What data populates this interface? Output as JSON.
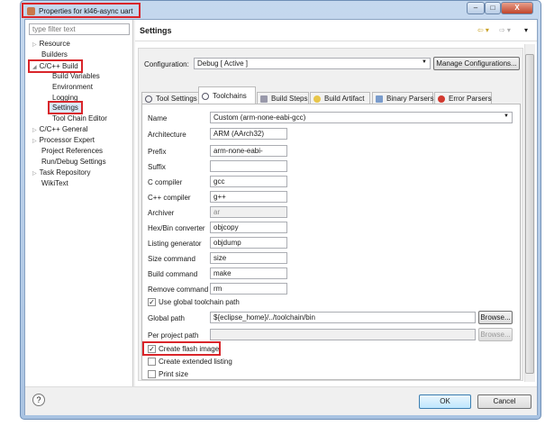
{
  "window": {
    "title": "Properties for kl46-async uart",
    "minimize": "–",
    "maximize": "□",
    "close": "X"
  },
  "filter": {
    "placeholder": "type filter text"
  },
  "tree": [
    {
      "label": "Resource",
      "expander": "▷"
    },
    {
      "label": "Builders",
      "expander": ""
    },
    {
      "label": "C/C++ Build",
      "expander": "◢"
    },
    {
      "label": "Build Variables",
      "expander": ""
    },
    {
      "label": "Environment",
      "expander": ""
    },
    {
      "label": "Logging",
      "expander": ""
    },
    {
      "label": "Settings",
      "expander": ""
    },
    {
      "label": "Tool Chain Editor",
      "expander": ""
    },
    {
      "label": "C/C++ General",
      "expander": "▷"
    },
    {
      "label": "Processor Expert",
      "expander": "▷"
    },
    {
      "label": "Project References",
      "expander": ""
    },
    {
      "label": "Run/Debug Settings",
      "expander": ""
    },
    {
      "label": "Task Repository",
      "expander": "▷"
    },
    {
      "label": "WikiText",
      "expander": ""
    }
  ],
  "header": {
    "title": "Settings",
    "back": "⇦ ▾",
    "forward": "⇨ ▾",
    "menu": "▾"
  },
  "config": {
    "label": "Configuration:",
    "value": "Debug  [ Active ]",
    "manage": "Manage Configurations..."
  },
  "tabs": [
    "Tool Settings",
    "Toolchains",
    "Build Steps",
    "Build Artifact",
    "Binary Parsers",
    "Error Parsers"
  ],
  "fields": {
    "name": {
      "label": "Name",
      "value": "Custom (arm-none-eabi-gcc)"
    },
    "arch": {
      "label": "Architecture",
      "value": "ARM (AArch32)"
    },
    "prefix": {
      "label": "Prefix",
      "value": "arm-none-eabi-"
    },
    "suffix": {
      "label": "Suffix",
      "value": ""
    },
    "cc": {
      "label": "C compiler",
      "value": "gcc"
    },
    "cxx": {
      "label": "C++ compiler",
      "value": "g++"
    },
    "ar": {
      "label": "Archiver",
      "value": "ar"
    },
    "hex": {
      "label": "Hex/Bin converter",
      "value": "objcopy"
    },
    "list": {
      "label": "Listing generator",
      "value": "objdump"
    },
    "size": {
      "label": "Size command",
      "value": "size"
    },
    "build": {
      "label": "Build command",
      "value": "make"
    },
    "rm": {
      "label": "Remove command",
      "value": "rm"
    }
  },
  "use_global": {
    "label": "Use global toolchain path",
    "checked": true
  },
  "global_path": {
    "label": "Global path",
    "value": "${eclipse_home}/../toolchain/bin",
    "browse": "Browse..."
  },
  "project_path": {
    "label": "Per project path",
    "value": "",
    "browse": "Browse..."
  },
  "options": [
    {
      "label": "Create flash image",
      "checked": true
    },
    {
      "label": "Create extended listing",
      "checked": false
    },
    {
      "label": "Print size",
      "checked": false
    }
  ],
  "footer": {
    "help": "?",
    "ok": "OK",
    "cancel": "Cancel"
  }
}
